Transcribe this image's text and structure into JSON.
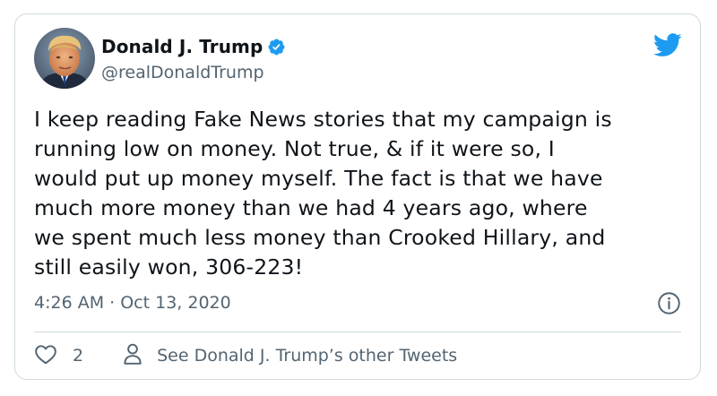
{
  "author": {
    "name": "Donald J. Trump",
    "handle": "@realDonaldTrump",
    "verified": true
  },
  "tweet": {
    "text": "I keep reading Fake News stories that my campaign is\nrunning low on money. Not true, & if it were so, I\nwould put up money myself. The fact is that we have\nmuch more money than we had 4 years ago, where\nwe spent much less money than Crooked Hillary, and\nstill easily won, 306-223!",
    "timestamp": "4:26 AM · Oct 13, 2020"
  },
  "actions": {
    "like_count": "2",
    "other_tweets_label": "See Donald J. Trump’s other Tweets"
  },
  "icons": {
    "brand": "twitter-bird-icon",
    "verified": "verified-badge-icon",
    "info": "info-icon",
    "like": "heart-icon",
    "profile": "person-icon"
  },
  "colors": {
    "brand_blue": "#1d9bf0",
    "text_primary": "#0f1419",
    "text_secondary": "#536471",
    "border": "#cfd9de"
  }
}
